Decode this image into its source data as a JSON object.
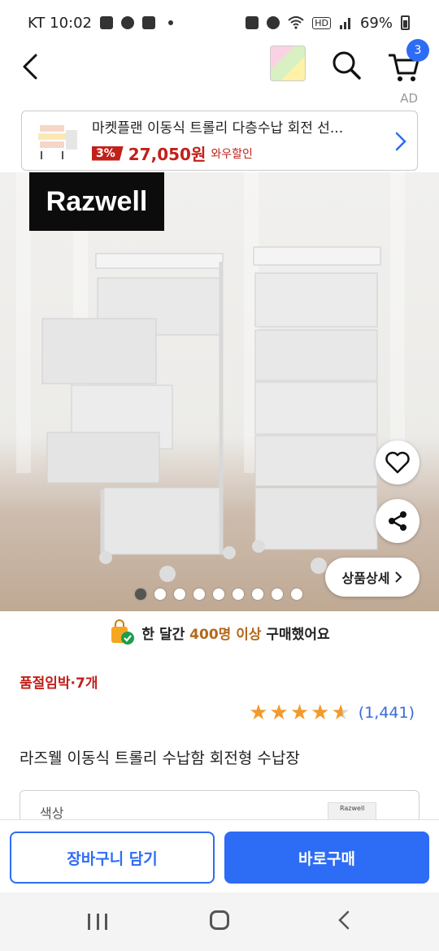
{
  "status_bar": {
    "carrier_time": "KT 10:02",
    "battery": "69%"
  },
  "header": {
    "cart_count": "3",
    "ad_label": "AD"
  },
  "ad_banner": {
    "title": "마켓플랜 이동식 트롤리 다층수납 회전 선...",
    "discount": "3%",
    "price": "27,050원",
    "promo": "와우할인"
  },
  "hero": {
    "brand_logo": "Razwell",
    "detail_button": "상품상세",
    "image_count": 9,
    "active_index": 0
  },
  "social_proof": {
    "prefix": "한 달간 ",
    "highlight": "400명 이상",
    "suffix": " 구매했어요"
  },
  "stock_notice": "품절임박·7개",
  "rating": {
    "stars": 4.5,
    "count": "(1,441)"
  },
  "product_title": "라즈웰 이동식 트롤리 수납함 회전형 수납장",
  "option": {
    "label": "색상",
    "thumb_brand": "Razwell"
  },
  "footer": {
    "cart_button": "장바구니 담기",
    "buy_button": "바로구매"
  },
  "colors": {
    "accent": "#2d6cf5",
    "sale": "#c2201a",
    "star": "#f39a2c"
  }
}
